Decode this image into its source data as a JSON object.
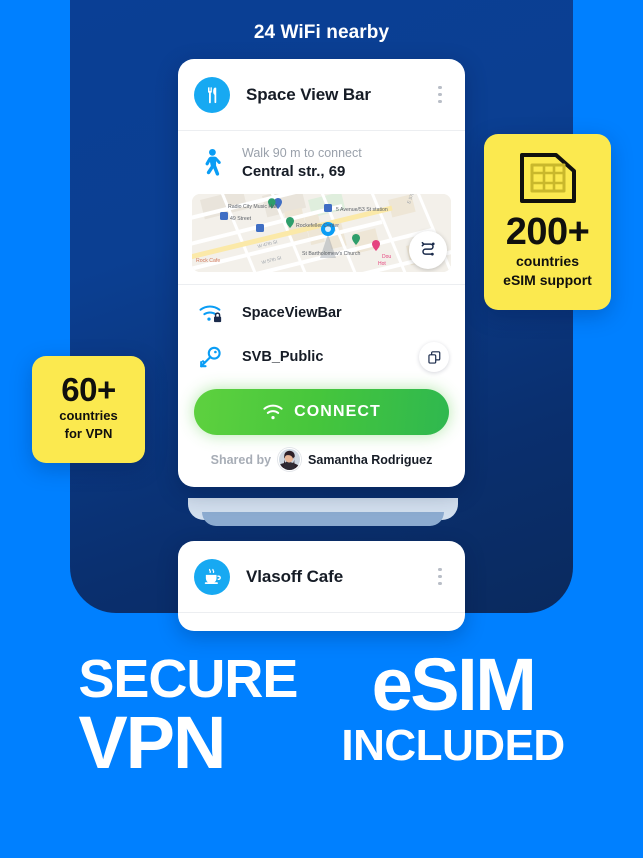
{
  "header": {
    "title": "24 WiFi nearby"
  },
  "card": {
    "place_icon": "restaurant-cutlery-icon",
    "place_name": "Space View Bar",
    "menu_icon": "kebab-menu-icon",
    "walk": {
      "icon": "walking-person-icon",
      "hint": "Walk 90 m to connect",
      "address": "Central str., 69"
    },
    "map": {
      "route_icon": "route-directions-icon",
      "labels": [
        "Radio City Music Hall",
        "49 Street",
        "5 Avenue/53 St station",
        "Rockefeller Center",
        "St Bartholomew's Church",
        "Rock Cafe",
        "W 47th St",
        "E 57th St"
      ]
    },
    "networks": [
      {
        "icon": "wifi-lock-icon",
        "label": "SpaceViewBar"
      },
      {
        "icon": "key-icon",
        "label": "SVB_Public",
        "action_icon": "copy-icon"
      }
    ],
    "connect": {
      "icon": "wifi-icon",
      "label": "CONNECT"
    },
    "shared": {
      "prefix": "Shared by",
      "avatar": "user-avatar",
      "name": "Samantha Rodriguez"
    }
  },
  "card2": {
    "place_icon": "coffee-cup-icon",
    "place_name": "Vlasoff Cafe",
    "menu_icon": "kebab-menu-icon"
  },
  "badges": {
    "esim": {
      "icon": "sim-card-icon",
      "number": "200+",
      "line1": "countries",
      "line2": "eSIM support"
    },
    "vpn": {
      "number": "60+",
      "line1": "countries",
      "line2": "for VPN"
    }
  },
  "headline": {
    "secure": "SECURE",
    "vpn": "VPN",
    "esim": "eSIM",
    "included": "INCLUDED"
  },
  "colors": {
    "background": "#0080ff",
    "panel": "#0a3f95",
    "badge": "#fbe94f",
    "connect": "#46c63c",
    "icon_blue": "#17a9f2"
  }
}
